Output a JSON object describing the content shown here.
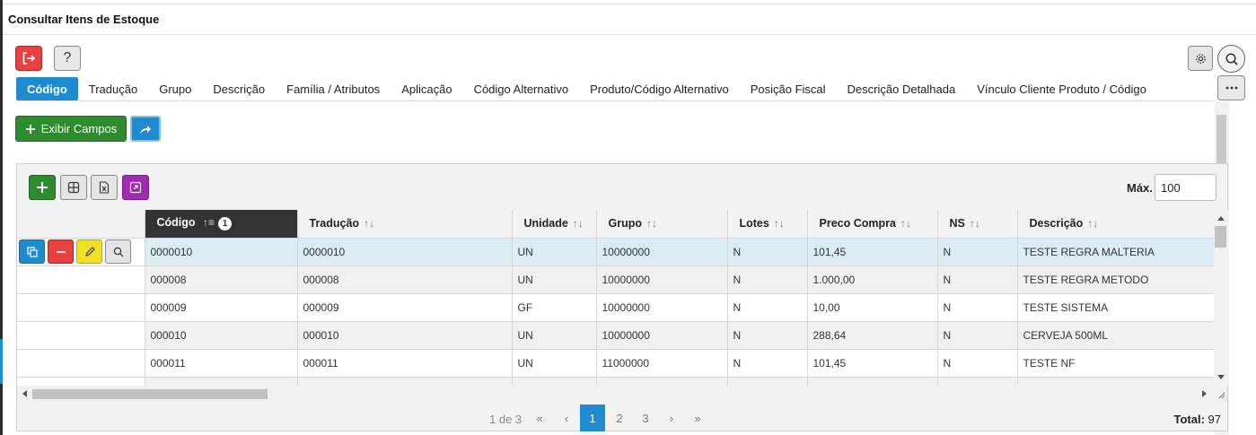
{
  "window": {
    "title": "Consultar Itens de Estoque"
  },
  "top_buttons": {
    "help_label": "?"
  },
  "tabs": [
    {
      "label": "Código",
      "active": true
    },
    {
      "label": "Tradução"
    },
    {
      "label": "Grupo"
    },
    {
      "label": "Descrição"
    },
    {
      "label": "Família / Atributos"
    },
    {
      "label": "Aplicação"
    },
    {
      "label": "Código Alternativo"
    },
    {
      "label": "Produto/Código Alternativo"
    },
    {
      "label": "Posição Fiscal"
    },
    {
      "label": "Descrição Detalhada"
    },
    {
      "label": "Vínculo Cliente Produto / Código"
    }
  ],
  "toolbar": {
    "exibir_campos_label": "Exibir Campos"
  },
  "grid_toolbar": {
    "max_label": "Máx.",
    "max_value": "100"
  },
  "columns": [
    {
      "label": "Código",
      "sort_order": "1"
    },
    {
      "label": "Tradução"
    },
    {
      "label": "Unidade"
    },
    {
      "label": "Grupo"
    },
    {
      "label": "Lotes"
    },
    {
      "label": "Preco Compra"
    },
    {
      "label": "NS"
    },
    {
      "label": "Descrição"
    }
  ],
  "rows": [
    [
      "0000010",
      "0000010",
      "UN",
      "10000000",
      "N",
      "101,45",
      "N",
      "TESTE REGRA MALTERIA"
    ],
    [
      "000008",
      "000008",
      "UN",
      "10000000",
      "N",
      "1.000,00",
      "N",
      "TESTE REGRA METODO"
    ],
    [
      "000009",
      "000009",
      "GF",
      "10000000",
      "N",
      "10,00",
      "N",
      "TESTE SISTEMA"
    ],
    [
      "000010",
      "000010",
      "UN",
      "10000000",
      "N",
      "288,64",
      "N",
      "CERVEJA 500ML"
    ],
    [
      "000011",
      "000011",
      "UN",
      "11000000",
      "N",
      "101,45",
      "N",
      "TESTE NF"
    ]
  ],
  "pagination": {
    "info": "1 de 3",
    "pages": [
      "1",
      "2",
      "3"
    ],
    "current": "1",
    "first": "«",
    "prev": "‹",
    "next": "›",
    "last": "»",
    "total_label": "Total:",
    "total_value": "97"
  },
  "colors": {
    "accent": "#1e8ad0",
    "success": "#2e8b2e",
    "danger": "#e8403f",
    "warning": "#f2e024",
    "purple": "#a12ab3"
  }
}
